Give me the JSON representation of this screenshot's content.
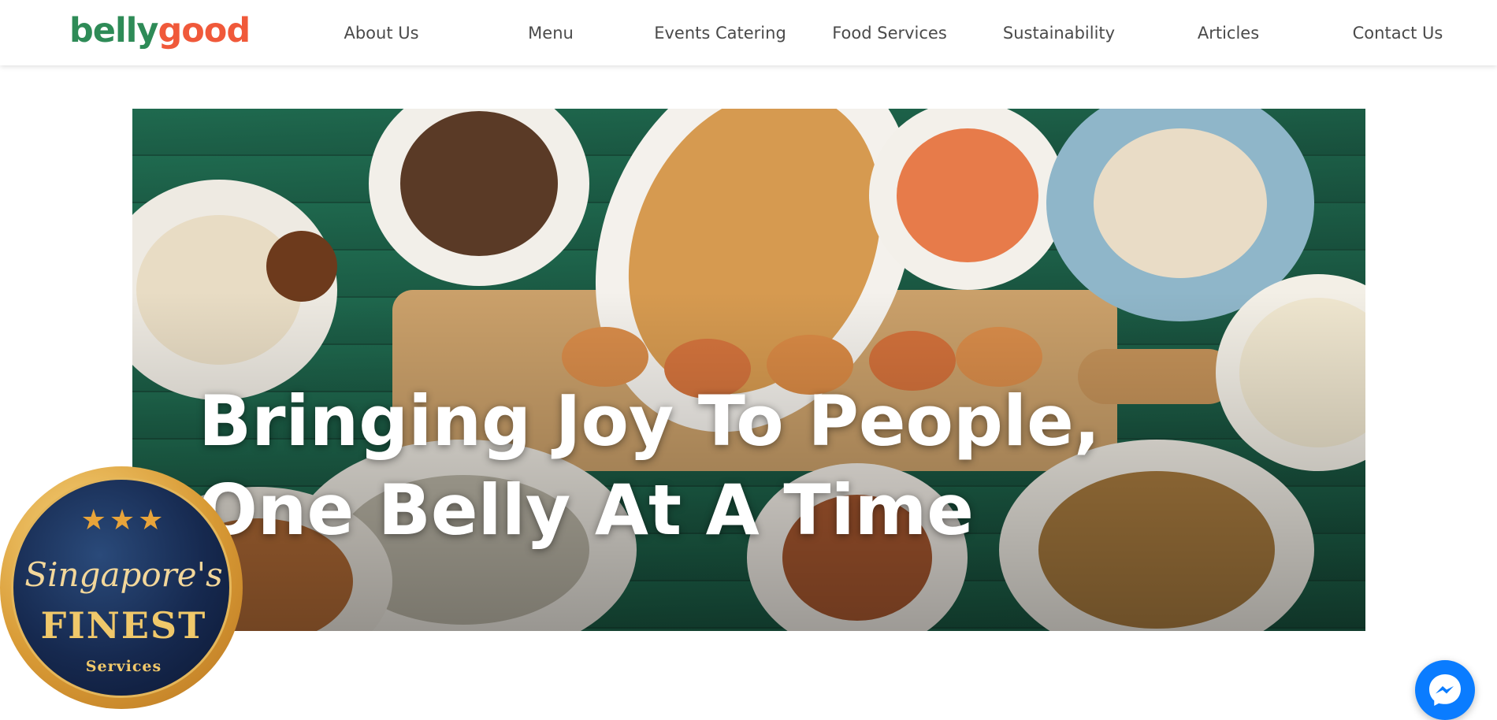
{
  "brand": {
    "logo_part1": "belly",
    "logo_part2": "good",
    "color_green": "#2e8b57",
    "color_orange": "#f0593a"
  },
  "nav": {
    "items": [
      {
        "label": "About Us"
      },
      {
        "label": "Menu"
      },
      {
        "label": "Events Catering"
      },
      {
        "label": "Food Services"
      },
      {
        "label": "Sustainability"
      },
      {
        "label": "Articles"
      },
      {
        "label": "Contact Us"
      }
    ]
  },
  "hero": {
    "title_line1": "Bringing Joy To People,",
    "title_line2": "One Belly At A Time"
  },
  "badge": {
    "stars": "★★★",
    "script": "Singapore's",
    "main": "FINEST",
    "sub": "Services"
  },
  "chat": {
    "icon": "messenger-icon",
    "color": "#0a7cff"
  }
}
